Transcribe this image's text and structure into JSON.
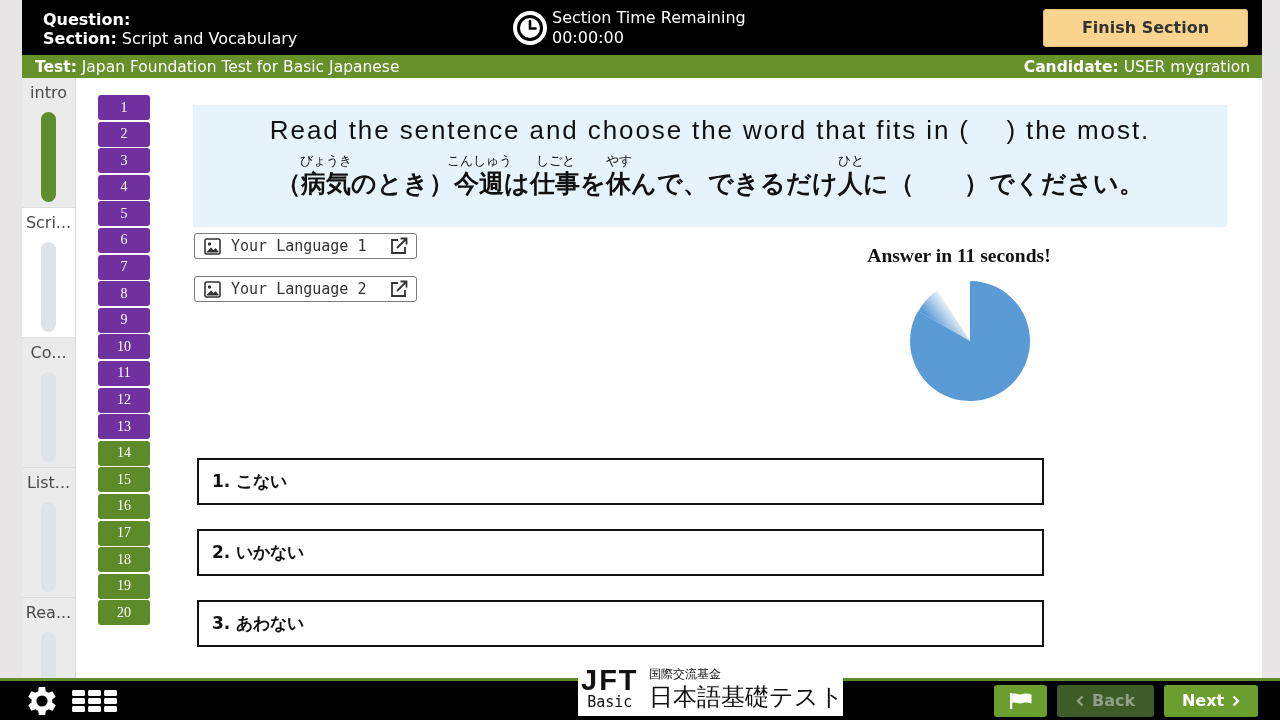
{
  "header": {
    "question_label": "Question:",
    "section": "**Section:** Script and Vocabulary",
    "timer_title": "Section Time Remaining",
    "timer_value": "00:00:00",
    "finish_button": "Finish Section"
  },
  "info_bar": {
    "test": "**Test:** Japan Foundation Test for Basic Japanese",
    "candidate": "**Candidate:** USER mygration"
  },
  "sections": [
    {
      "label": "intro",
      "selected": false,
      "completed": true
    },
    {
      "label": "Scri...",
      "selected": true,
      "completed": false
    },
    {
      "label": "Co...",
      "selected": false,
      "completed": false
    },
    {
      "label": "List...",
      "selected": false,
      "completed": false
    },
    {
      "label": "Rea...",
      "selected": false,
      "completed": false
    }
  ],
  "question_nav": [
    {
      "number": "1",
      "color": "#7030a0"
    },
    {
      "number": "2",
      "color": "#7030a0"
    },
    {
      "number": "3",
      "color": "#7030a0"
    },
    {
      "number": "4",
      "color": "#7030a0"
    },
    {
      "number": "5",
      "color": "#7030a0"
    },
    {
      "number": "6",
      "color": "#7030a0"
    },
    {
      "number": "7",
      "color": "#7030a0"
    },
    {
      "number": "8",
      "color": "#7030a0"
    },
    {
      "number": "9",
      "color": "#7030a0"
    },
    {
      "number": "10",
      "color": "#7030a0"
    },
    {
      "number": "11",
      "color": "#7030a0"
    },
    {
      "number": "12",
      "color": "#7030a0"
    },
    {
      "number": "13",
      "color": "#7030a0"
    },
    {
      "number": "14",
      "color": "#5e8b2a"
    },
    {
      "number": "15",
      "color": "#5e8b2a"
    },
    {
      "number": "16",
      "color": "#5e8b2a"
    },
    {
      "number": "17",
      "color": "#5e8b2a"
    },
    {
      "number": "18",
      "color": "#5e8b2a"
    },
    {
      "number": "19",
      "color": "#5e8b2a"
    },
    {
      "number": "20",
      "color": "#5e8b2a"
    }
  ],
  "question": {
    "instruction": "Read the sentence and choose the word that fits in (    ) the most.",
    "sentence": [
      {
        "text": "（"
      },
      {
        "text": "病気",
        "ruby": "びょうき"
      },
      {
        "text": "のとき）"
      },
      {
        "text": "今週",
        "ruby": "こんしゅう"
      },
      {
        "text": "は"
      },
      {
        "text": "仕事",
        "ruby": "しごと"
      },
      {
        "text": "を"
      },
      {
        "text": "休",
        "ruby": "やす"
      },
      {
        "text": "んで、できるだけ"
      },
      {
        "text": "人",
        "ruby": "ひと"
      },
      {
        "text": "に（　　）でください。"
      }
    ]
  },
  "language_buttons": [
    "Your Language 1",
    "Your Language 2"
  ],
  "timer": {
    "label": "Answer in 11 seconds!"
  },
  "options": [
    {
      "label": "1. こない",
      "selected": false
    },
    {
      "label": "2. いかない",
      "selected": false
    },
    {
      "label": "3. あわない",
      "selected": false
    }
  ],
  "footer": {
    "logo": {
      "mark": "JFT",
      "mark_sub": "Basic",
      "organization": "国際交流基金",
      "title": "日本語基礎テスト"
    },
    "buttons": [
      {
        "kind": "flag",
        "disabled": false
      },
      {
        "kind": "back",
        "label": "Back",
        "disabled": true
      },
      {
        "kind": "next",
        "label": "Next",
        "disabled": false
      }
    ]
  }
}
